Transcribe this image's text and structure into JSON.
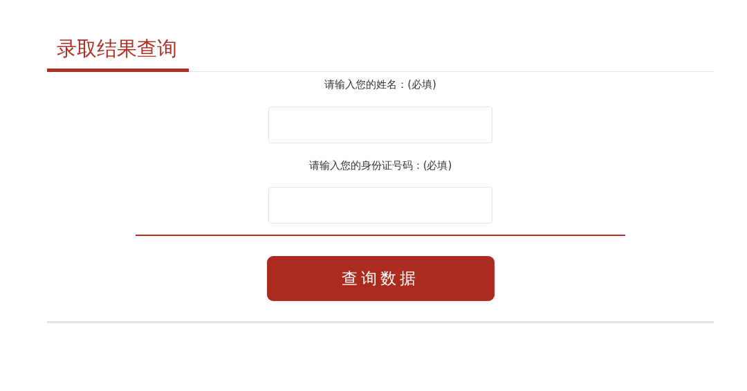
{
  "title": "录取结果查询",
  "fields": [
    {
      "label": "请输入您的姓名：(必填)"
    },
    {
      "label": "请输入您的身份证号码：(必填)"
    }
  ],
  "submit_button": "查询数据"
}
